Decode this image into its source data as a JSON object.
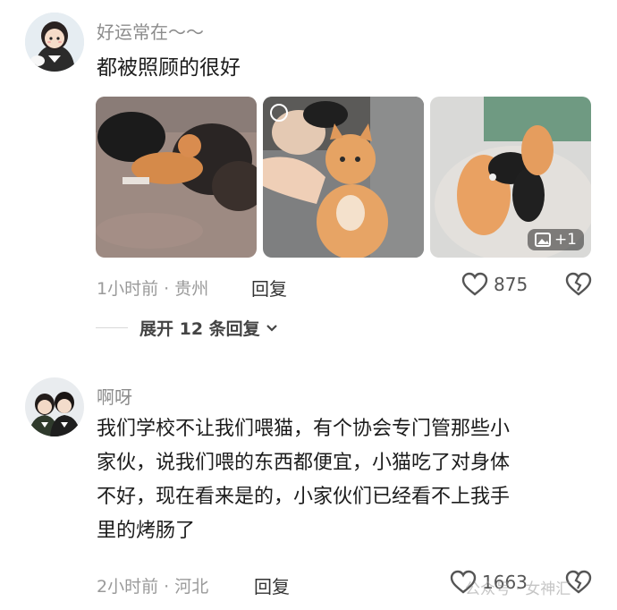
{
  "comment1": {
    "username": "好运常在～～",
    "text": "都被照顾的很好",
    "meta": "1小时前 · 贵州",
    "reply_label": "回复",
    "like_count": "875",
    "extra_photos_badge": "+1",
    "expand_label": "展开 12 条回复"
  },
  "comment2": {
    "username": "啊呀",
    "text_lines": [
      "我们学校不让我们喂猫，有个协会专门管那些小",
      "家伙，说我们喂的东西都便宜，小猫吃了对身体",
      "不好，现在看来是的，小家伙们已经看不上我手",
      "里的烤肠了"
    ],
    "meta": "2小时前 · 河北",
    "reply_label": "回复",
    "like_count": "1663"
  },
  "watermark": "公众号 · 女神汇",
  "icons": {
    "like": "heart-outline-icon",
    "dislike": "broken-heart-icon",
    "expand": "chevron-down-icon",
    "gallery": "image-icon"
  },
  "colors": {
    "background": "#ffffff",
    "username": "#8c8c8c",
    "meta": "#9a9a9a",
    "text": "#1c1c1c"
  }
}
